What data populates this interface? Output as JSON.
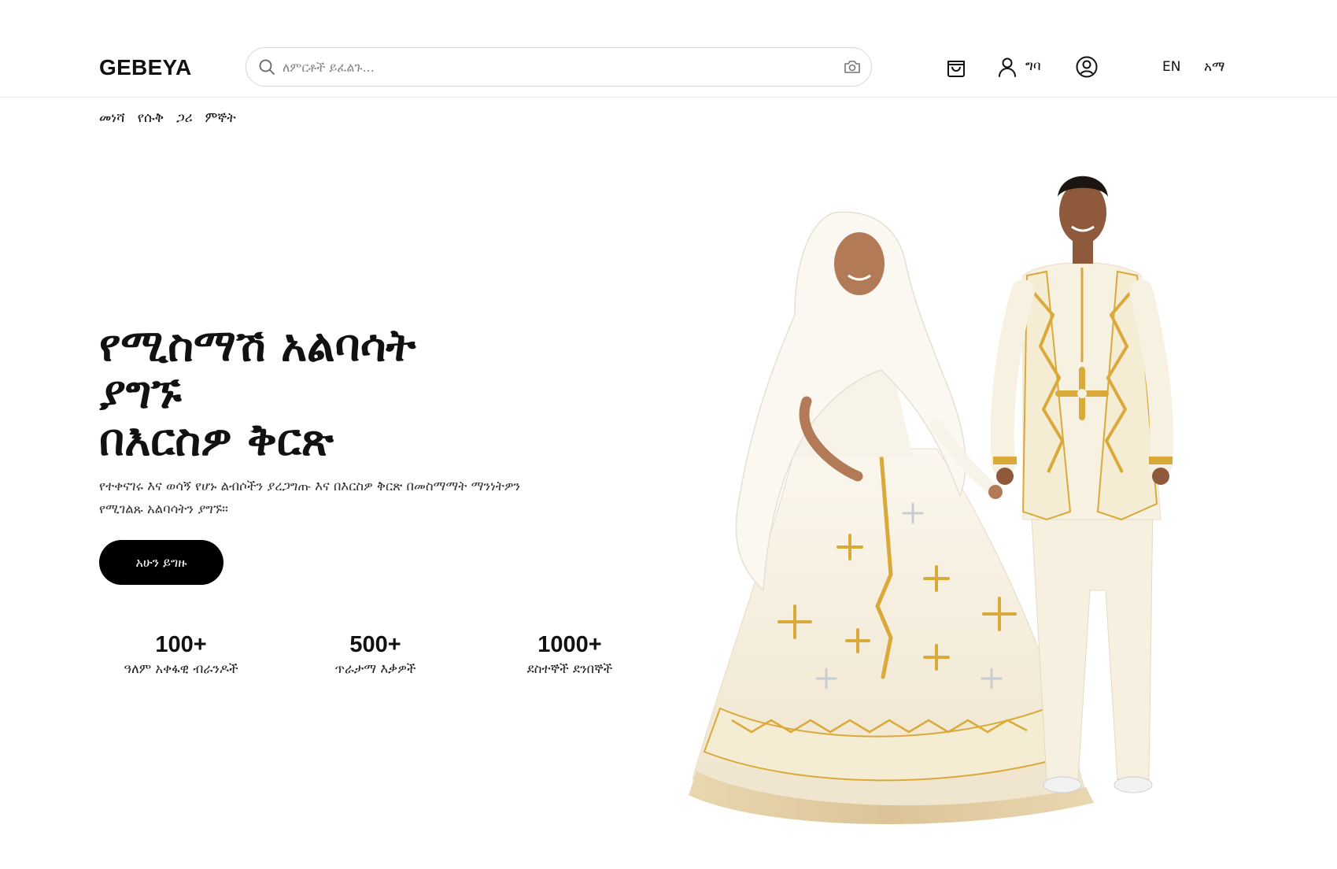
{
  "header": {
    "logo": "GEBEYA",
    "search": {
      "placeholder": "ለምርቶች ይፈልጉ..."
    },
    "login_label": "ግባ",
    "languages": [
      "EN",
      "አማ"
    ],
    "icons": [
      "search-icon",
      "camera-icon",
      "shopping-bag-icon",
      "user-icon",
      "account-circle-icon"
    ]
  },
  "nav": {
    "items": [
      "መነሻ",
      "የሱቅ",
      "ጋሪ",
      "ምኞት"
    ]
  },
  "hero": {
    "title": "የሚስማሽ አልባሳት\nያግኙ\nበእርስዎ ቅርጽ",
    "subtitle": "የተቀናገሩ እና ወሳኝ የሆኑ ልብሶችን ያረጋግጡ እና በእርስዎ ቅርጽ በመስማማት ማንነትዎን የሚገልጹ አልባሳትን ያግኙ።",
    "cta": "አሁን ይግዙ"
  },
  "stats": [
    {
      "value": "100+",
      "label": "ዓለም አቀፋዊ ብራንዶች"
    },
    {
      "value": "500+",
      "label": "ጥራታማ እቃዎች"
    },
    {
      "value": "1000+",
      "label": "ደስተኞች ደንበኞች"
    }
  ],
  "colors": {
    "accent": "#000000",
    "gold": "#d9a93a",
    "cream": "#f6f0e0",
    "border": "#e5e5e5"
  }
}
